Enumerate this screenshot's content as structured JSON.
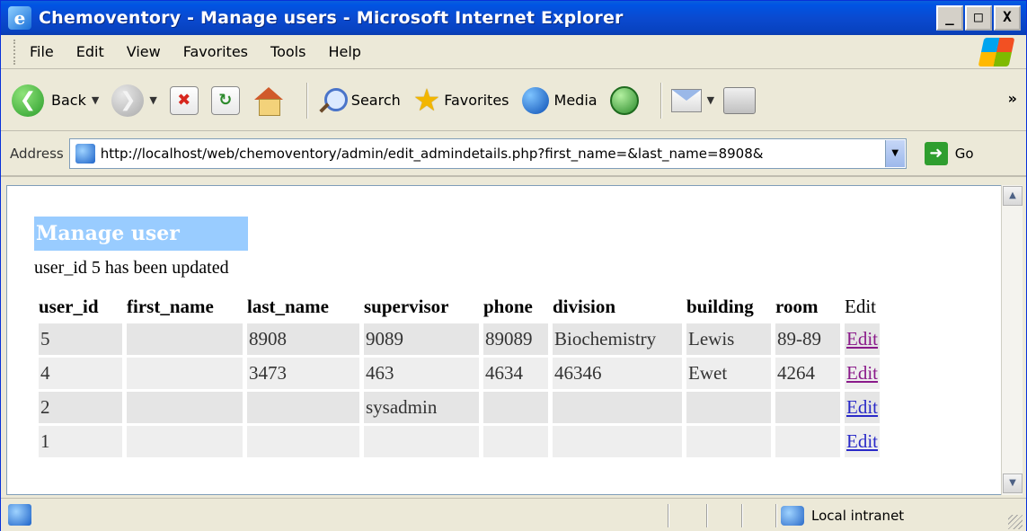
{
  "window": {
    "title": "Chemoventory - Manage users - Microsoft Internet Explorer",
    "controls": [
      "_",
      "□",
      "X"
    ]
  },
  "menu": {
    "items": [
      "File",
      "Edit",
      "View",
      "Favorites",
      "Tools",
      "Help"
    ]
  },
  "toolbar": {
    "back_label": "Back",
    "search_label": "Search",
    "favorites_label": "Favorites",
    "media_label": "Media",
    "overflow": "»"
  },
  "address": {
    "label": "Address",
    "url": "http://localhost/web/chemoventory/admin/edit_admindetails.php?first_name=&last_name=8908&",
    "go_label": "Go"
  },
  "page": {
    "heading": "Manage user",
    "message": "user_id 5 has been updated"
  },
  "table": {
    "headers": [
      "user_id",
      "first_name",
      "last_name",
      "supervisor",
      "phone",
      "division",
      "building",
      "room",
      "Edit"
    ],
    "rows": [
      {
        "user_id": "5",
        "first_name": "",
        "last_name": "8908",
        "supervisor": "9089",
        "phone": "89089",
        "division": "Biochemistry",
        "building": "Lewis",
        "room": "89-89",
        "edit": "Edit"
      },
      {
        "user_id": "4",
        "first_name": "",
        "last_name": "3473",
        "supervisor": "463",
        "phone": "4634",
        "division": "46346",
        "building": "Ewet",
        "room": "4264",
        "edit": "Edit"
      },
      {
        "user_id": "2",
        "first_name": "",
        "last_name": "",
        "supervisor": "sysadmin",
        "phone": "",
        "division": "",
        "building": "",
        "room": "",
        "edit": "Edit"
      },
      {
        "user_id": "1",
        "first_name": "",
        "last_name": "",
        "supervisor": "",
        "phone": "",
        "division": "",
        "building": "",
        "room": "",
        "edit": "Edit"
      }
    ]
  },
  "status": {
    "zone": "Local intranet"
  },
  "colors": {
    "title_bar": "#0a4ad0",
    "heading_bg": "#99ccff",
    "link": "#2a2ac8",
    "visited_link": "#8a1a8a"
  }
}
